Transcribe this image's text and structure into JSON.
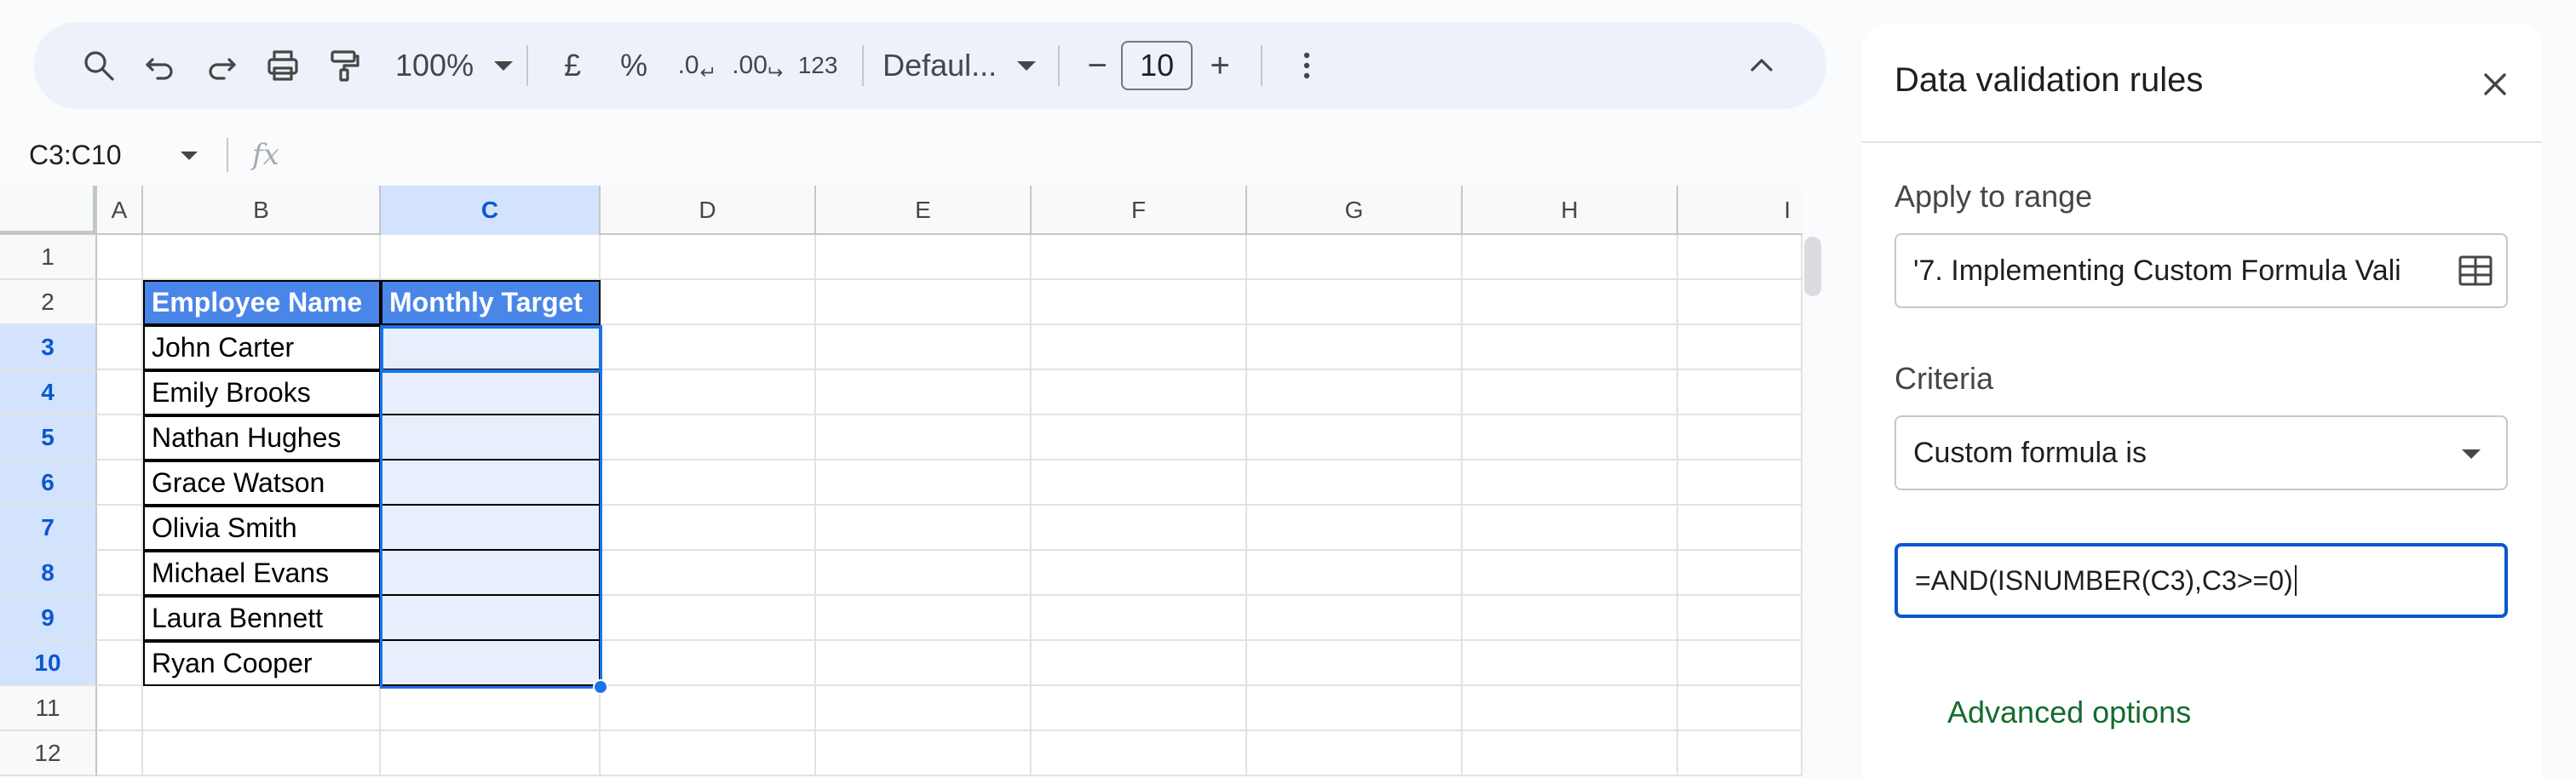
{
  "toolbar": {
    "zoom": "100%",
    "currency": "£",
    "percent": "%",
    "decrease_decimal": ".0",
    "increase_decimal": ".00",
    "number_format": "123",
    "font": "Defaul...",
    "font_size": "10",
    "minus": "−",
    "plus": "+",
    "icons": [
      "search-icon",
      "undo-icon",
      "redo-icon",
      "print-icon",
      "paint-format-icon",
      "more-vert-icon",
      "chevron-up-icon"
    ]
  },
  "formula_bar": {
    "name_box": "C3:C10",
    "fx": "fx"
  },
  "grid": {
    "columns": [
      "A",
      "B",
      "C",
      "D",
      "E",
      "F",
      "G",
      "H",
      "I"
    ],
    "rows": [
      "1",
      "2",
      "3",
      "4",
      "5",
      "6",
      "7",
      "8",
      "9",
      "10",
      "11",
      "12"
    ],
    "header_cells": [
      "Employee Name",
      "Monthly Target"
    ],
    "names": [
      "John Carter",
      "Emily Brooks",
      "Nathan Hughes",
      "Grace Watson",
      "Olivia Smith",
      "Michael Evans",
      "Laura Bennett",
      "Ryan Cooper"
    ],
    "header_color": "#4a86e8",
    "selection_color": "#1a73e8"
  },
  "panel": {
    "title": "Data validation rules",
    "apply_label": "Apply to range",
    "apply_value": "'7. Implementing Custom Formula Vali",
    "criteria_label": "Criteria",
    "criteria_value": "Custom formula is",
    "formula_value": "=AND(ISNUMBER(C3),C3>=0)",
    "advanced": "Advanced options",
    "accent_color": "#0b57d0"
  }
}
